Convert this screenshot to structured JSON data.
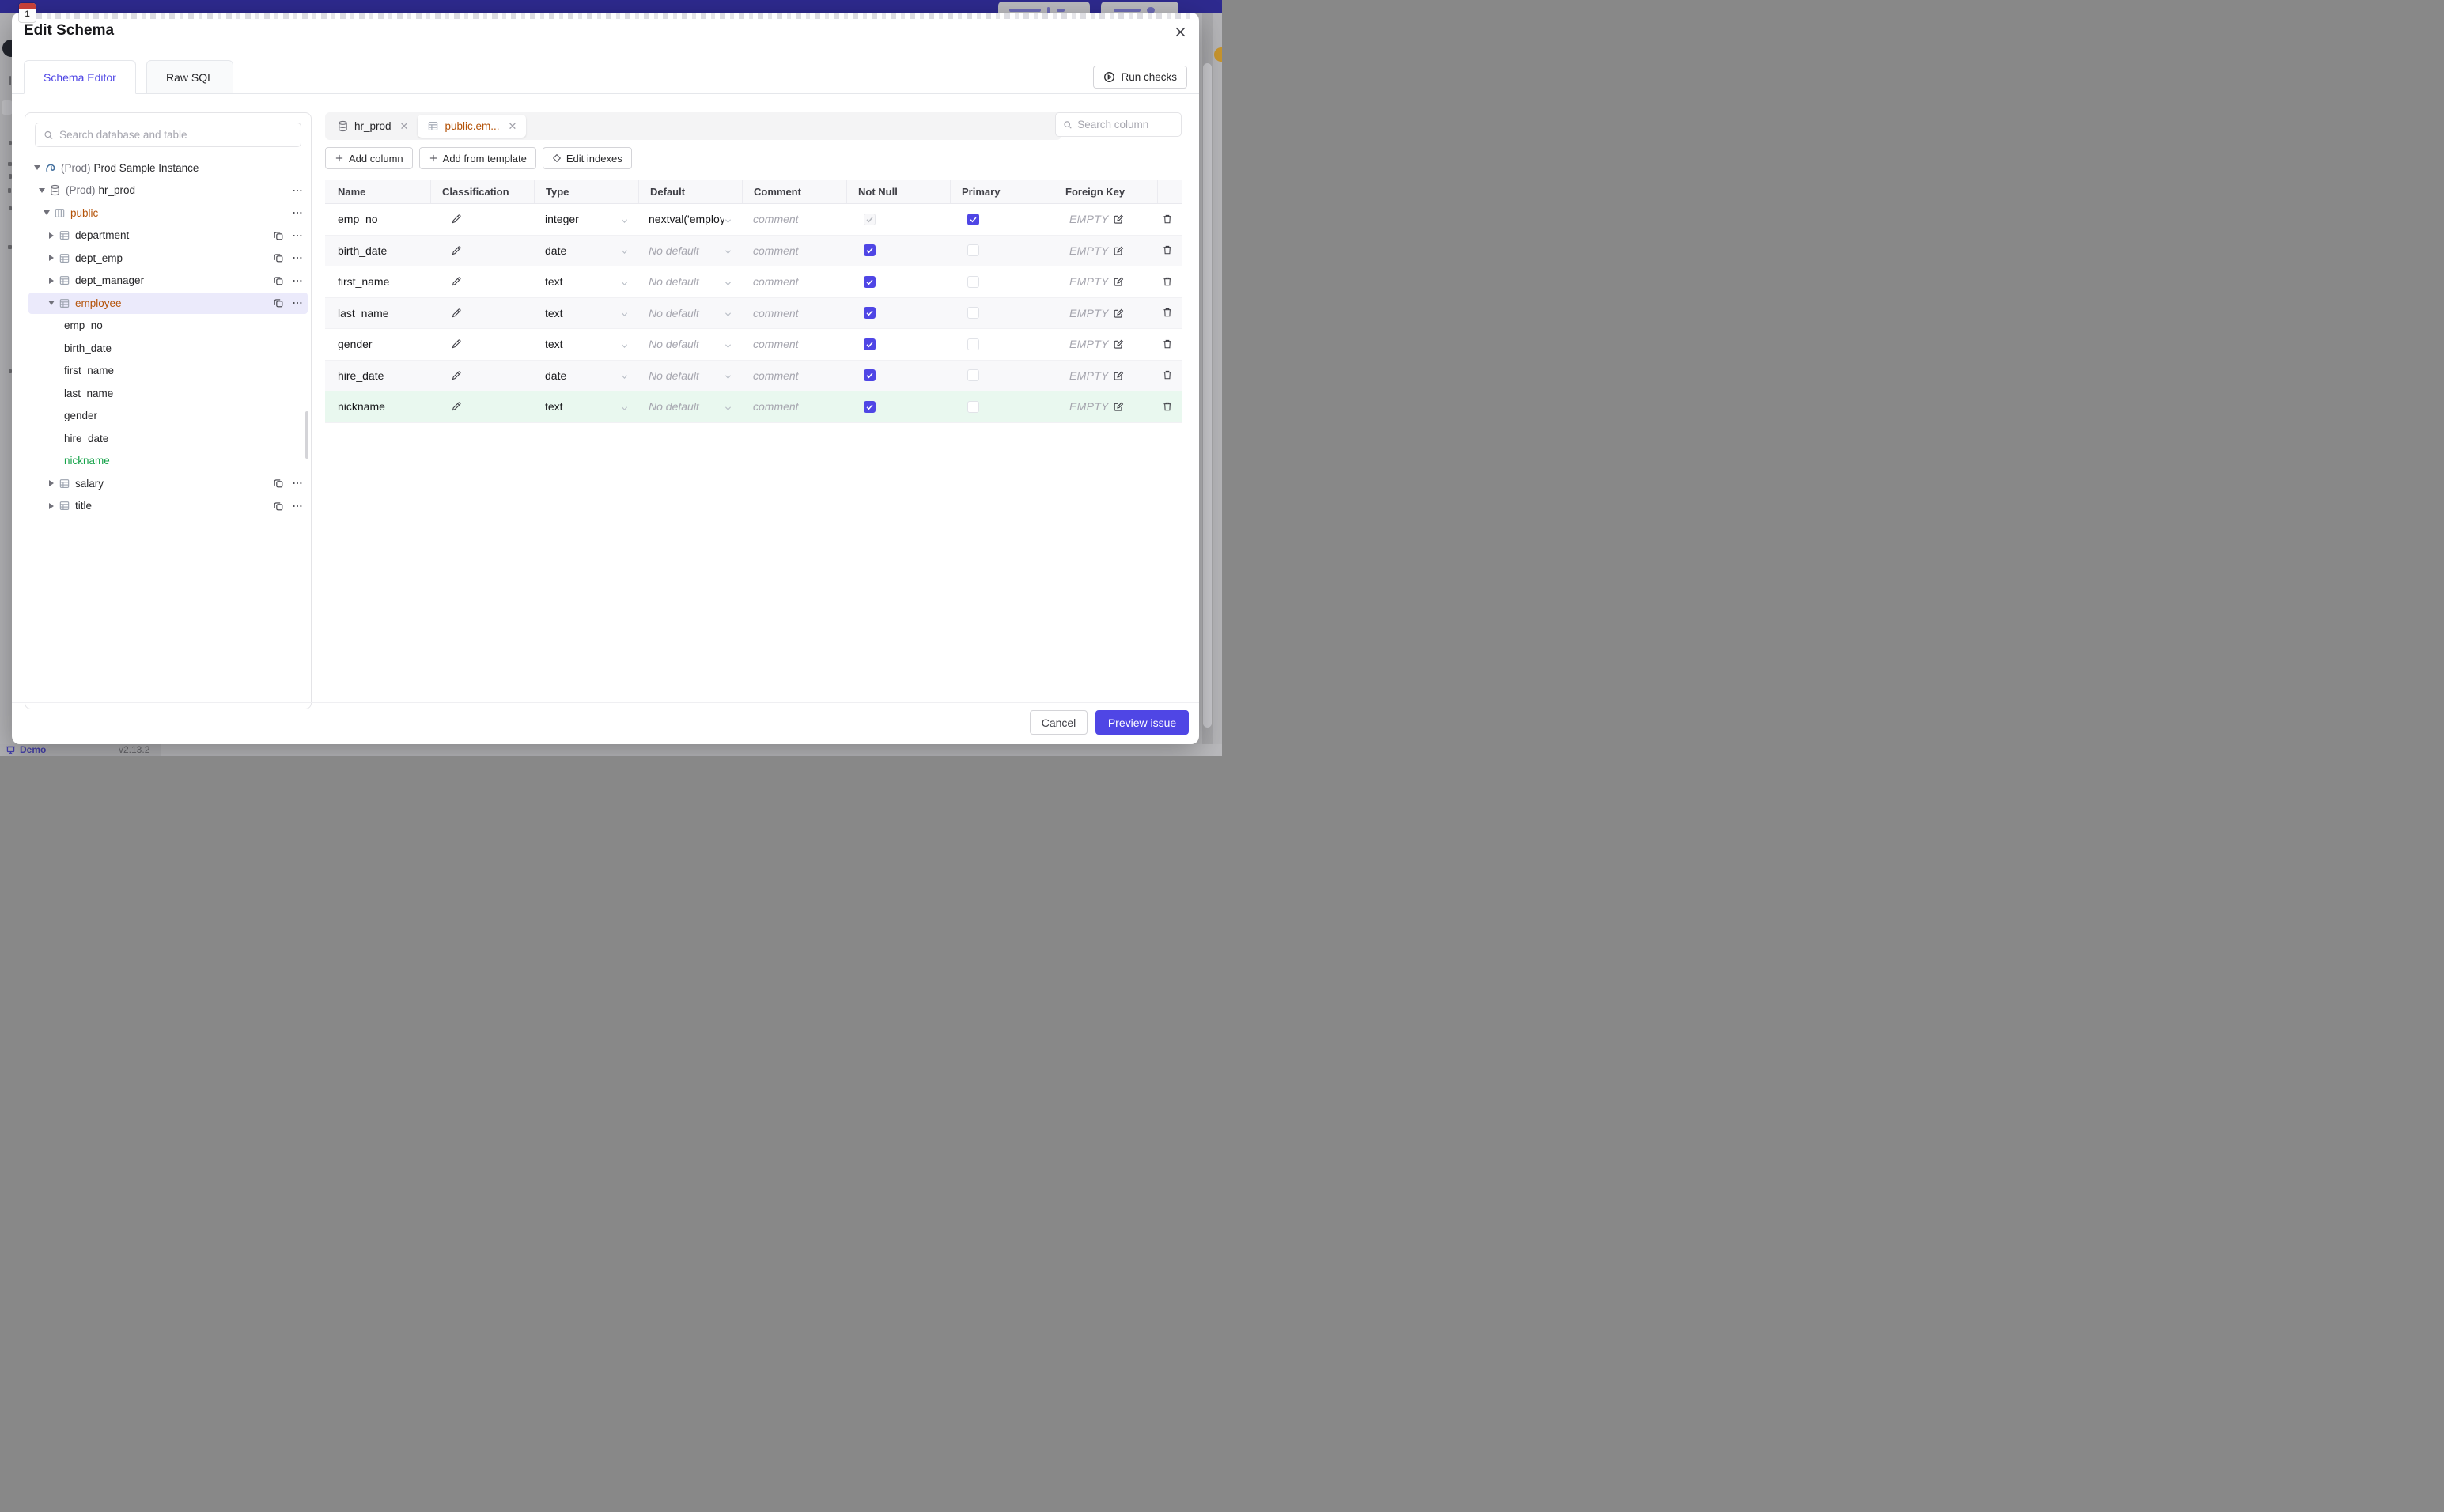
{
  "colors": {
    "accent": "#4f46e5",
    "banner": "#2e2a8f",
    "amber": "#b45309",
    "green_text": "#16a34a",
    "green_row": "#e9f8ef"
  },
  "background": {
    "demo_label": "Demo",
    "version": "v2.13.2"
  },
  "modal": {
    "title": "Edit Schema",
    "tabs": [
      {
        "label": "Schema Editor",
        "active": true
      },
      {
        "label": "Raw SQL",
        "active": false
      }
    ],
    "run_checks_label": "Run checks"
  },
  "sidebar": {
    "search_placeholder": "Search database and table",
    "tree": [
      {
        "lvl": 0,
        "caret": "down",
        "icon": "pg",
        "prefix": "(Prod)",
        "label": "Prod Sample Instance",
        "acts": []
      },
      {
        "lvl": 1,
        "caret": "down",
        "icon": "db",
        "prefix": "(Prod)",
        "label": "hr_prod",
        "acts": [
          "more"
        ]
      },
      {
        "lvl": 2,
        "caret": "down",
        "icon": "schema",
        "label": "public",
        "color": "amber",
        "acts": [
          "more"
        ]
      },
      {
        "lvl": 3,
        "caret": "right",
        "icon": "table",
        "label": "department",
        "acts": [
          "copy",
          "more"
        ]
      },
      {
        "lvl": 3,
        "caret": "right",
        "icon": "table",
        "label": "dept_emp",
        "acts": [
          "copy",
          "more"
        ]
      },
      {
        "lvl": 3,
        "caret": "right",
        "icon": "table",
        "label": "dept_manager",
        "acts": [
          "copy",
          "more"
        ]
      },
      {
        "lvl": 3,
        "caret": "down",
        "icon": "table",
        "label": "employee",
        "color": "amber",
        "selected": true,
        "acts": [
          "copy",
          "more"
        ]
      },
      {
        "lvl": "col",
        "label": "emp_no"
      },
      {
        "lvl": "col",
        "label": "birth_date"
      },
      {
        "lvl": "col",
        "label": "first_name"
      },
      {
        "lvl": "col",
        "label": "last_name"
      },
      {
        "lvl": "col",
        "label": "gender"
      },
      {
        "lvl": "col",
        "label": "hire_date"
      },
      {
        "lvl": "col",
        "label": "nickname",
        "color": "green-text"
      },
      {
        "lvl": 3,
        "caret": "right",
        "icon": "table",
        "label": "salary",
        "acts": [
          "copy",
          "more"
        ]
      },
      {
        "lvl": 3,
        "caret": "right",
        "icon": "table",
        "label": "title",
        "acts": [
          "copy",
          "more"
        ]
      }
    ]
  },
  "editor": {
    "chips": [
      {
        "icon": "db",
        "label": "hr_prod",
        "active": false
      },
      {
        "icon": "table",
        "label": "public.em...",
        "active": true,
        "color": "amber"
      }
    ],
    "toolbar": [
      {
        "icon": "plus",
        "label": "Add column"
      },
      {
        "icon": "plus",
        "label": "Add from template"
      },
      {
        "icon": "diamond",
        "label": "Edit indexes"
      }
    ],
    "column_search_placeholder": "Search column",
    "table": {
      "headers": [
        "Name",
        "Classification",
        "Type",
        "Default",
        "Comment",
        "Not Null",
        "Primary",
        "Foreign Key",
        ""
      ],
      "comment_placeholder": "comment",
      "no_default_placeholder": "No default",
      "fk_empty_label": "EMPTY",
      "rows": [
        {
          "name": "emp_no",
          "type": "integer",
          "default": "nextval('employ",
          "has_default": true,
          "not_null": "disabled-checked",
          "primary": true,
          "new": false
        },
        {
          "name": "birth_date",
          "type": "date",
          "default": "No default",
          "has_default": false,
          "not_null": "checked",
          "primary": false,
          "new": false
        },
        {
          "name": "first_name",
          "type": "text",
          "default": "No default",
          "has_default": false,
          "not_null": "checked",
          "primary": false,
          "new": false
        },
        {
          "name": "last_name",
          "type": "text",
          "default": "No default",
          "has_default": false,
          "not_null": "checked",
          "primary": false,
          "new": false
        },
        {
          "name": "gender",
          "type": "text",
          "default": "No default",
          "has_default": false,
          "not_null": "checked",
          "primary": false,
          "new": false
        },
        {
          "name": "hire_date",
          "type": "date",
          "default": "No default",
          "has_default": false,
          "not_null": "checked",
          "primary": false,
          "new": false
        },
        {
          "name": "nickname",
          "type": "text",
          "default": "No default",
          "has_default": false,
          "not_null": "checked",
          "primary": false,
          "new": true
        }
      ]
    }
  },
  "footer": {
    "cancel_label": "Cancel",
    "preview_label": "Preview issue"
  }
}
